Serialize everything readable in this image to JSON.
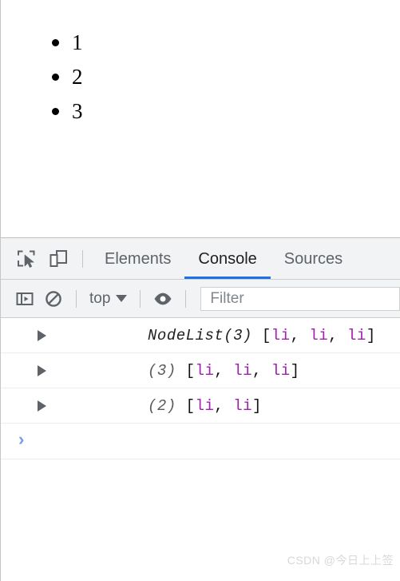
{
  "page": {
    "list_items": [
      "1",
      "2",
      "3"
    ],
    "bullet_icon": "bullet-disc"
  },
  "devtools": {
    "toolbar_icons": [
      {
        "name": "inspect-element-icon",
        "title": "Inspect element"
      },
      {
        "name": "device-toolbar-icon",
        "title": "Toggle device toolbar"
      }
    ],
    "tabs": [
      {
        "label": "Elements",
        "active": false
      },
      {
        "label": "Console",
        "active": true
      },
      {
        "label": "Sources",
        "active": false
      }
    ],
    "active_tab": "Console",
    "accent_color": "#1a73e8",
    "console_toolbar": {
      "sidebar_toggle_icon": "console-sidebar-icon",
      "clear_console_icon": "clear-console-icon",
      "context_label": "top",
      "context_caret_icon": "chevron-down-icon",
      "live_expression_icon": "eye-icon",
      "filter_placeholder": "Filter"
    },
    "console_messages": [
      {
        "disclosure_icon": "disclosure-triangle-icon",
        "constructor": "NodeList(3)",
        "count": "",
        "open_bracket": " [",
        "nodes": [
          "li",
          "li",
          "li"
        ],
        "separator": ", ",
        "close_bracket": "]"
      },
      {
        "disclosure_icon": "disclosure-triangle-icon",
        "constructor": "",
        "count": "(3)",
        "open_bracket": " [",
        "nodes": [
          "li",
          "li",
          "li"
        ],
        "separator": ", ",
        "close_bracket": "]"
      },
      {
        "disclosure_icon": "disclosure-triangle-icon",
        "constructor": "",
        "count": "(2)",
        "open_bracket": " [",
        "nodes": [
          "li",
          "li"
        ],
        "separator": ", ",
        "close_bracket": "]"
      }
    ],
    "prompt": {
      "chevron": "›",
      "value": ""
    }
  },
  "watermark": {
    "text": "CSDN @今日上上签"
  }
}
